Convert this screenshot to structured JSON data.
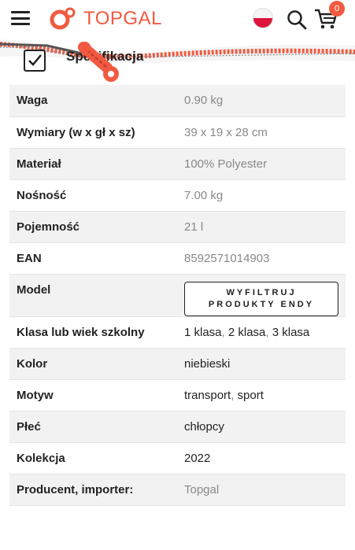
{
  "header": {
    "logo_text": "TOPGAL",
    "cart_count": "0"
  },
  "colors": {
    "brand": "#f15a40",
    "row_alt": "#f2f2f2",
    "muted_text": "#888888"
  },
  "icons": [
    "menu-icon",
    "topgal-logo-icon",
    "poland-flag-icon",
    "search-icon",
    "cart-icon",
    "checkbox-icon",
    "zipper-decoration"
  ],
  "section": {
    "title_prefix": "Spe",
    "title_suffix": "ifikacja"
  },
  "specs": {
    "weight": {
      "label": "Waga",
      "value": "0.90 kg"
    },
    "dimensions": {
      "label": "Wymiary (w x gł x sz)",
      "value": "39 x 19 x 28 cm"
    },
    "material": {
      "label": "Materiał",
      "value": "100% Polyester"
    },
    "capacity_load": {
      "label": "Nośność",
      "value": "7.00 kg"
    },
    "volume": {
      "label": "Pojemność",
      "value": "21 l"
    },
    "ean": {
      "label": "EAN",
      "value": "8592571014903"
    },
    "model": {
      "label": "Model",
      "button_line1": "WYFILTRUJ",
      "button_line2": "PRODUKTY ENDY"
    },
    "school_class": {
      "label": "Klasa lub wiek szkolny",
      "values": [
        "1 klasa",
        "2 klasa",
        "3 klasa"
      ]
    },
    "color": {
      "label": "Kolor",
      "value": "niebieski"
    },
    "motif": {
      "label": "Motyw",
      "values": [
        "transport",
        "sport"
      ]
    },
    "gender": {
      "label": "Płeć",
      "value": "chłopcy"
    },
    "collection": {
      "label": "Kolekcja",
      "value": "2022"
    },
    "producer": {
      "label": "Producent, importer:",
      "value": "Topgal"
    }
  }
}
